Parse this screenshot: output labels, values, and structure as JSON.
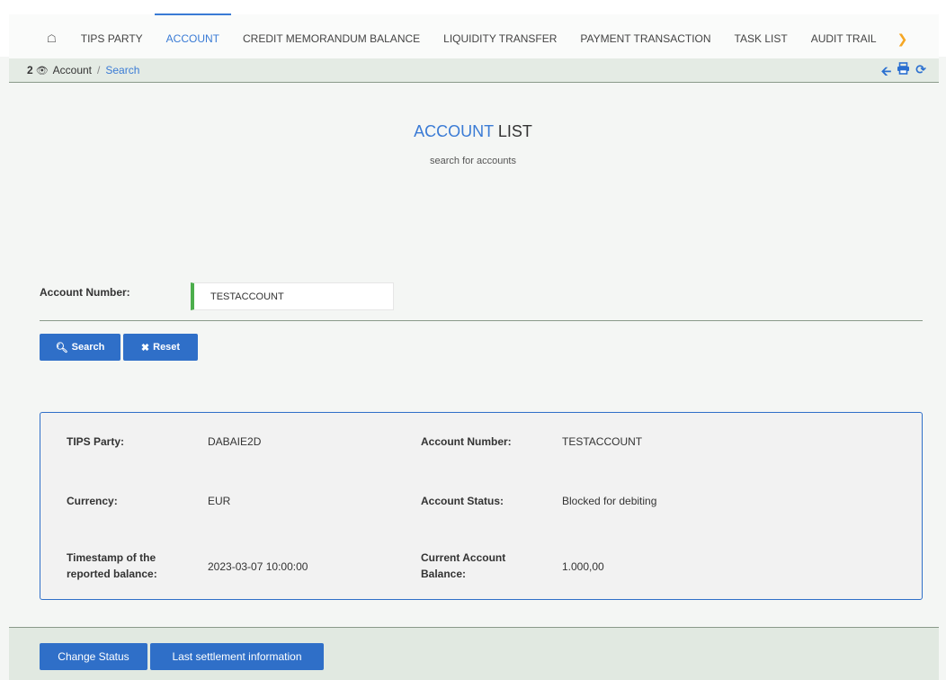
{
  "nav": {
    "home_icon": "home-icon",
    "items": [
      "TIPS PARTY",
      "ACCOUNT",
      "CREDIT MEMORANDUM BALANCE",
      "LIQUIDITY TRANSFER",
      "PAYMENT TRANSACTION",
      "TASK LIST",
      "AUDIT TRAIL"
    ],
    "active": "ACCOUNT",
    "more_icon": "chevron-right-icon"
  },
  "breadcrumb": {
    "count": "2",
    "account": "Account",
    "separator": "/",
    "current": "Search"
  },
  "page": {
    "title_accent": "ACCOUNT",
    "title_rest": "LIST",
    "subtitle": "search for accounts"
  },
  "search": {
    "account_number_label": "Account Number:",
    "account_number_value": "TESTACCOUNT",
    "search_button": "Search",
    "reset_button": "Reset"
  },
  "result": {
    "tips_party_label": "TIPS Party:",
    "tips_party_value": "DABAIE2D",
    "account_number_label": "Account Number:",
    "account_number_value": "TESTACCOUNT",
    "currency_label": "Currency:",
    "currency_value": "EUR",
    "account_status_label": "Account Status:",
    "account_status_value": "Blocked for debiting",
    "timestamp_label_1": "Timestamp of the",
    "timestamp_label_2": "reported balance:",
    "timestamp_value": "2023-03-07 10:00:00",
    "balance_label_1": "Current Account",
    "balance_label_2": "Balance:",
    "balance_value": "1.000,00"
  },
  "footer": {
    "change_status": "Change Status",
    "last_settlement": "Last settlement information"
  },
  "colors": {
    "accent": "#3a7bd5",
    "button": "#2f6fc8",
    "input_valid": "#4cae4c",
    "more_chevron": "#f5a623"
  }
}
